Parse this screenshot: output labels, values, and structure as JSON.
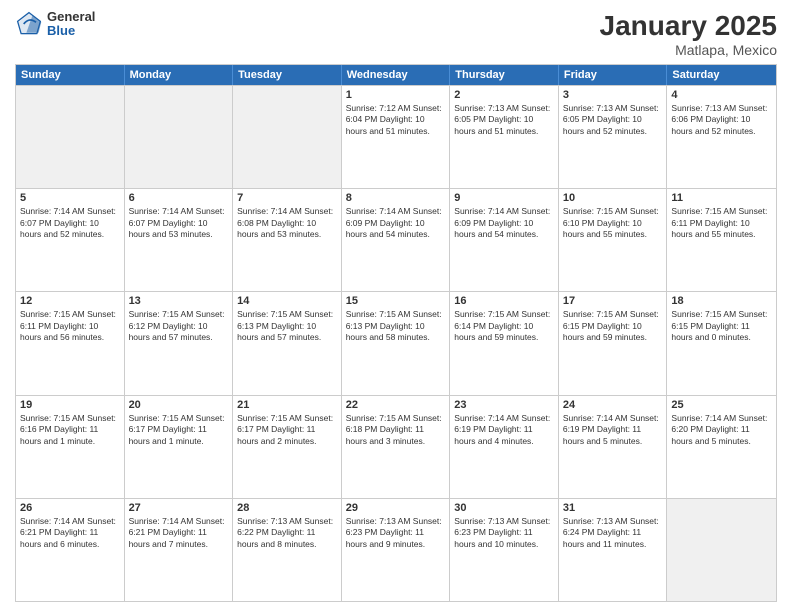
{
  "header": {
    "logo_general": "General",
    "logo_blue": "Blue",
    "title": "January 2025",
    "subtitle": "Matlapa, Mexico"
  },
  "days_of_week": [
    "Sunday",
    "Monday",
    "Tuesday",
    "Wednesday",
    "Thursday",
    "Friday",
    "Saturday"
  ],
  "weeks": [
    [
      {
        "day": "",
        "text": "",
        "shaded": true
      },
      {
        "day": "",
        "text": "",
        "shaded": true
      },
      {
        "day": "",
        "text": "",
        "shaded": true
      },
      {
        "day": "1",
        "text": "Sunrise: 7:12 AM\nSunset: 6:04 PM\nDaylight: 10 hours\nand 51 minutes."
      },
      {
        "day": "2",
        "text": "Sunrise: 7:13 AM\nSunset: 6:05 PM\nDaylight: 10 hours\nand 51 minutes."
      },
      {
        "day": "3",
        "text": "Sunrise: 7:13 AM\nSunset: 6:05 PM\nDaylight: 10 hours\nand 52 minutes."
      },
      {
        "day": "4",
        "text": "Sunrise: 7:13 AM\nSunset: 6:06 PM\nDaylight: 10 hours\nand 52 minutes."
      }
    ],
    [
      {
        "day": "5",
        "text": "Sunrise: 7:14 AM\nSunset: 6:07 PM\nDaylight: 10 hours\nand 52 minutes."
      },
      {
        "day": "6",
        "text": "Sunrise: 7:14 AM\nSunset: 6:07 PM\nDaylight: 10 hours\nand 53 minutes."
      },
      {
        "day": "7",
        "text": "Sunrise: 7:14 AM\nSunset: 6:08 PM\nDaylight: 10 hours\nand 53 minutes."
      },
      {
        "day": "8",
        "text": "Sunrise: 7:14 AM\nSunset: 6:09 PM\nDaylight: 10 hours\nand 54 minutes."
      },
      {
        "day": "9",
        "text": "Sunrise: 7:14 AM\nSunset: 6:09 PM\nDaylight: 10 hours\nand 54 minutes."
      },
      {
        "day": "10",
        "text": "Sunrise: 7:15 AM\nSunset: 6:10 PM\nDaylight: 10 hours\nand 55 minutes."
      },
      {
        "day": "11",
        "text": "Sunrise: 7:15 AM\nSunset: 6:11 PM\nDaylight: 10 hours\nand 55 minutes."
      }
    ],
    [
      {
        "day": "12",
        "text": "Sunrise: 7:15 AM\nSunset: 6:11 PM\nDaylight: 10 hours\nand 56 minutes."
      },
      {
        "day": "13",
        "text": "Sunrise: 7:15 AM\nSunset: 6:12 PM\nDaylight: 10 hours\nand 57 minutes."
      },
      {
        "day": "14",
        "text": "Sunrise: 7:15 AM\nSunset: 6:13 PM\nDaylight: 10 hours\nand 57 minutes."
      },
      {
        "day": "15",
        "text": "Sunrise: 7:15 AM\nSunset: 6:13 PM\nDaylight: 10 hours\nand 58 minutes."
      },
      {
        "day": "16",
        "text": "Sunrise: 7:15 AM\nSunset: 6:14 PM\nDaylight: 10 hours\nand 59 minutes."
      },
      {
        "day": "17",
        "text": "Sunrise: 7:15 AM\nSunset: 6:15 PM\nDaylight: 10 hours\nand 59 minutes."
      },
      {
        "day": "18",
        "text": "Sunrise: 7:15 AM\nSunset: 6:15 PM\nDaylight: 11 hours\nand 0 minutes."
      }
    ],
    [
      {
        "day": "19",
        "text": "Sunrise: 7:15 AM\nSunset: 6:16 PM\nDaylight: 11 hours\nand 1 minute."
      },
      {
        "day": "20",
        "text": "Sunrise: 7:15 AM\nSunset: 6:17 PM\nDaylight: 11 hours\nand 1 minute."
      },
      {
        "day": "21",
        "text": "Sunrise: 7:15 AM\nSunset: 6:17 PM\nDaylight: 11 hours\nand 2 minutes."
      },
      {
        "day": "22",
        "text": "Sunrise: 7:15 AM\nSunset: 6:18 PM\nDaylight: 11 hours\nand 3 minutes."
      },
      {
        "day": "23",
        "text": "Sunrise: 7:14 AM\nSunset: 6:19 PM\nDaylight: 11 hours\nand 4 minutes."
      },
      {
        "day": "24",
        "text": "Sunrise: 7:14 AM\nSunset: 6:19 PM\nDaylight: 11 hours\nand 5 minutes."
      },
      {
        "day": "25",
        "text": "Sunrise: 7:14 AM\nSunset: 6:20 PM\nDaylight: 11 hours\nand 5 minutes."
      }
    ],
    [
      {
        "day": "26",
        "text": "Sunrise: 7:14 AM\nSunset: 6:21 PM\nDaylight: 11 hours\nand 6 minutes."
      },
      {
        "day": "27",
        "text": "Sunrise: 7:14 AM\nSunset: 6:21 PM\nDaylight: 11 hours\nand 7 minutes."
      },
      {
        "day": "28",
        "text": "Sunrise: 7:13 AM\nSunset: 6:22 PM\nDaylight: 11 hours\nand 8 minutes."
      },
      {
        "day": "29",
        "text": "Sunrise: 7:13 AM\nSunset: 6:23 PM\nDaylight: 11 hours\nand 9 minutes."
      },
      {
        "day": "30",
        "text": "Sunrise: 7:13 AM\nSunset: 6:23 PM\nDaylight: 11 hours\nand 10 minutes."
      },
      {
        "day": "31",
        "text": "Sunrise: 7:13 AM\nSunset: 6:24 PM\nDaylight: 11 hours\nand 11 minutes."
      },
      {
        "day": "",
        "text": "",
        "shaded": true
      }
    ]
  ]
}
